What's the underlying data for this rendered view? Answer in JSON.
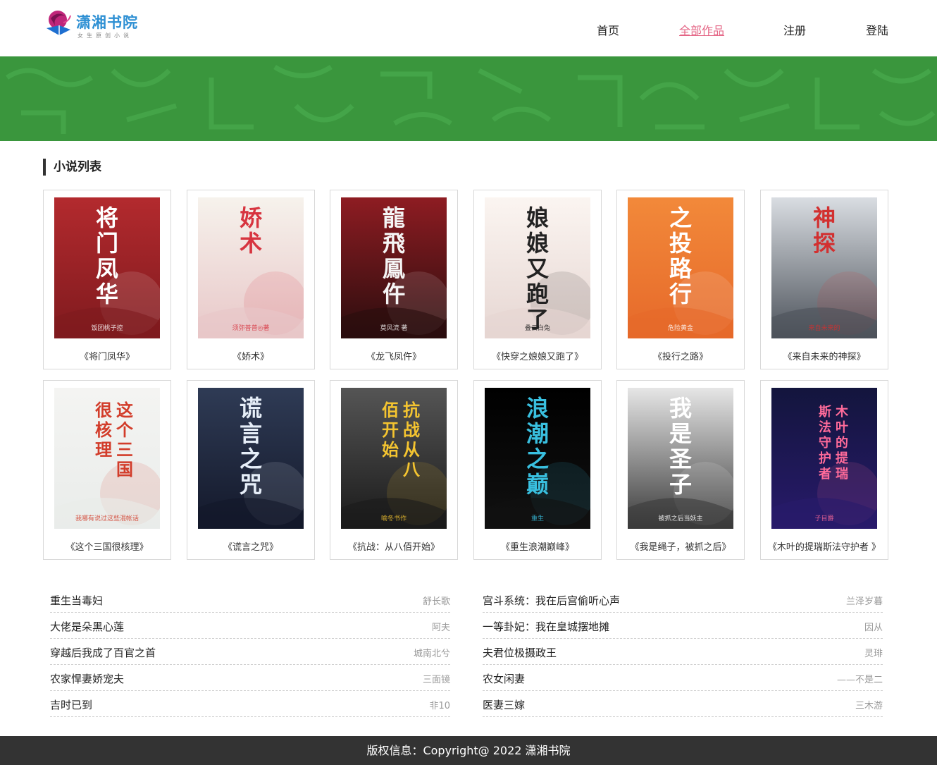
{
  "site": {
    "logo_title": "潇湘书院",
    "logo_subtitle": "女生原创小说",
    "nav": [
      "首页",
      "全部作品",
      "注册",
      "登陆"
    ],
    "active_nav": "全部作品"
  },
  "colors": {
    "banner": "#3a963d",
    "accent": "#e46585",
    "footer": "#333333"
  },
  "section": {
    "title": "小说列表"
  },
  "books": [
    {
      "title": "《将门凤华》",
      "cover_text": "将门凤华",
      "cover_sub": "饭团桃子控"
    },
    {
      "title": "《娇术》",
      "cover_text": "娇术",
      "cover_sub": "须弥普普◎著"
    },
    {
      "title": "《龙飞凤仵》",
      "cover_text": "龍飛鳳仵",
      "cover_sub": "莫风流 著"
    },
    {
      "title": "《快穿之娘娘又跑了》",
      "cover_text": "娘娘又跑了",
      "cover_sub": "叠云白兔"
    },
    {
      "title": "《投行之路》",
      "cover_text": "之投路行",
      "cover_sub": "危险黄金"
    },
    {
      "title": "《来自未来的神探》",
      "cover_text": "神探",
      "cover_sub": "来自未来的"
    },
    {
      "title": "《这个三国很核理》",
      "cover_text": "这个三国很核理",
      "cover_sub": "我哪有说过这些混帐话"
    },
    {
      "title": "《谎言之咒》",
      "cover_text": "谎言之咒",
      "cover_sub": ""
    },
    {
      "title": "《抗战：从八佰开始》",
      "cover_text": "抗战从八佰开始",
      "cover_sub": "喻冬书作"
    },
    {
      "title": "《重生浪潮巅峰》",
      "cover_text": "浪潮之巅",
      "cover_sub": "重生"
    },
    {
      "title": "《我是绳子，被抓之后》",
      "cover_text": "我是圣子",
      "cover_sub": "被抓之后当妖主"
    },
    {
      "title": "《木叶的提瑞斯法守护者 》",
      "cover_text": "木叶的提瑞斯法守护者",
      "cover_sub": "子目爵"
    }
  ],
  "list_left": [
    {
      "title": "重生当毒妇",
      "author": "舒长歌"
    },
    {
      "title": "大佬是朵黑心莲",
      "author": "阿夫"
    },
    {
      "title": "穿越后我成了百官之首",
      "author": "城南北兮"
    },
    {
      "title": "农家悍妻娇宠夫",
      "author": "三面镜"
    },
    {
      "title": "吉时已到",
      "author": "非10"
    }
  ],
  "list_right": [
    {
      "title": "宫斗系统：我在后宫偷听心声",
      "author": "兰泽岁暮"
    },
    {
      "title": "一等卦妃：我在皇城摆地摊",
      "author": "因从"
    },
    {
      "title": "夫君位极摄政王",
      "author": "灵琲"
    },
    {
      "title": "农女闲妻",
      "author": "——不是二"
    },
    {
      "title": "医妻三嫁",
      "author": "三木游"
    }
  ],
  "footer": {
    "text": "版权信息：Copyright@ 2022 潇湘书院"
  }
}
